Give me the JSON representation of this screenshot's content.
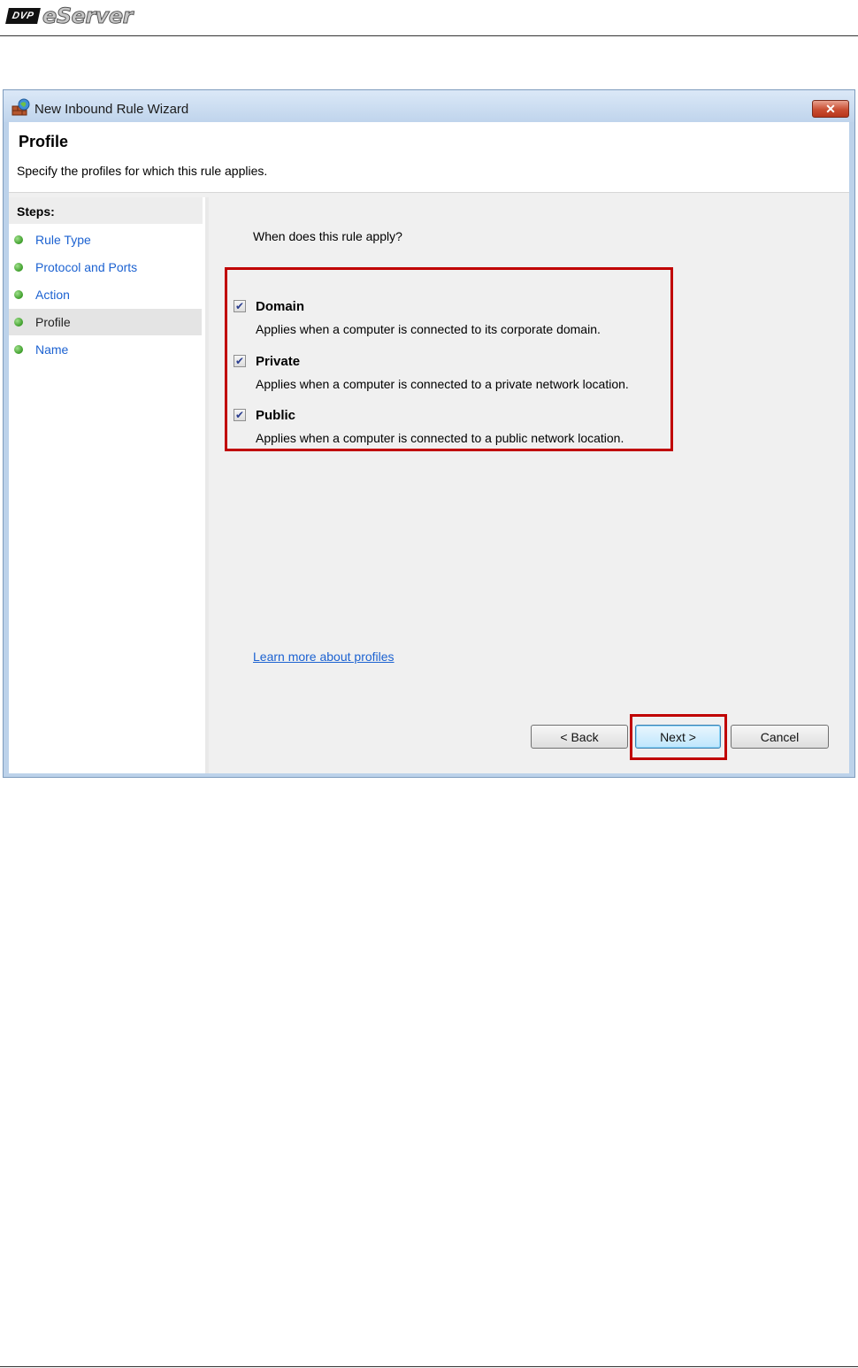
{
  "document": {
    "logo_badge": "DVP",
    "logo_text": "eServer"
  },
  "window": {
    "title": "New Inbound Rule Wizard",
    "close_label": "✕"
  },
  "header": {
    "title": "Profile",
    "subtitle": "Specify the profiles for which this rule applies."
  },
  "steps": {
    "label": "Steps:",
    "items": [
      {
        "label": "Rule Type"
      },
      {
        "label": "Protocol and Ports"
      },
      {
        "label": "Action"
      },
      {
        "label": "Profile"
      },
      {
        "label": "Name"
      }
    ]
  },
  "content": {
    "question": "When does this rule apply?",
    "options": [
      {
        "label": "Domain",
        "description": "Applies when a computer is connected to its corporate domain.",
        "checked": true
      },
      {
        "label": "Private",
        "description": "Applies when a computer is connected to a private network location.",
        "checked": true
      },
      {
        "label": "Public",
        "description": "Applies when a computer is connected to a public network location.",
        "checked": true
      }
    ],
    "learn_more": "Learn more about profiles"
  },
  "buttons": {
    "back": "< Back",
    "next": "Next >",
    "cancel": "Cancel"
  },
  "colors": {
    "highlight": "#c00000",
    "link": "#1c62d1"
  }
}
